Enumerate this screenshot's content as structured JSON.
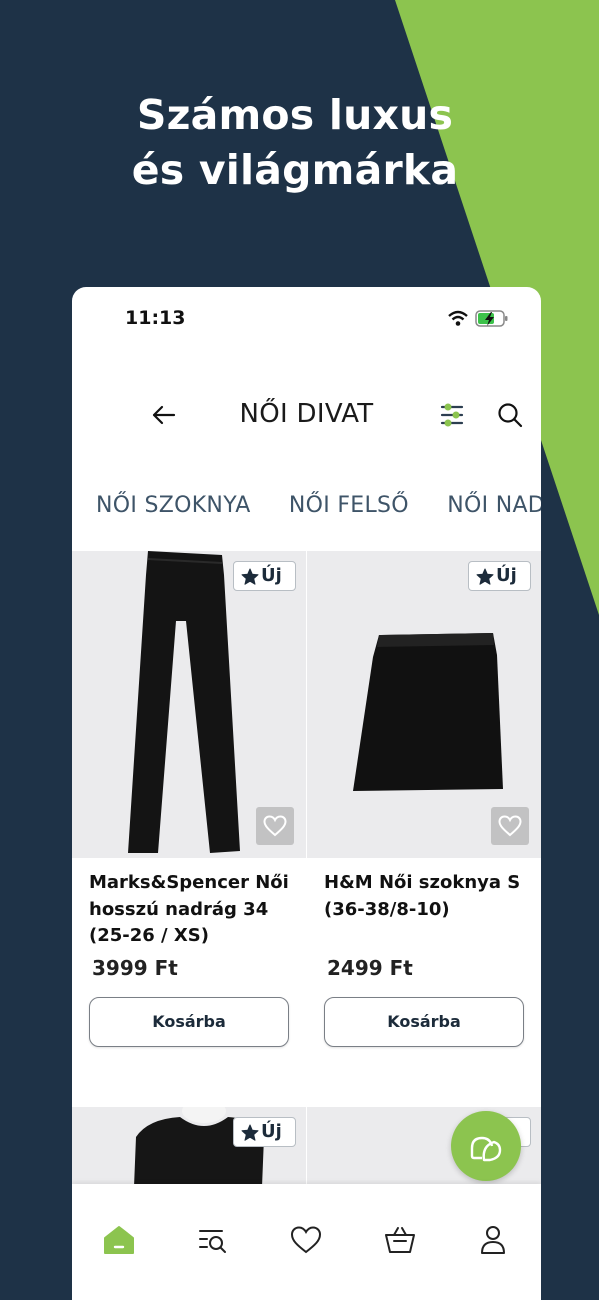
{
  "promo": {
    "headline_line1": "Számos luxus",
    "headline_line2": "és világmárka"
  },
  "status_bar": {
    "time": "11:13"
  },
  "app_bar": {
    "title": "NŐI DIVAT"
  },
  "categories": [
    "NŐI SZOKNYA",
    "NŐI FELSŐ",
    "NŐI NAD"
  ],
  "products": [
    {
      "badge": "Új",
      "name": "Marks&Spencer Női hosszú nadrág 34 (25-26 / XS)",
      "price": "3999 Ft",
      "cart_label": "Kosárba"
    },
    {
      "badge": "Új",
      "name": "H&M Női szoknya S (36-38/8-10)",
      "price": "2499 Ft",
      "cart_label": "Kosárba"
    }
  ],
  "next_row": {
    "badge": "Új"
  },
  "colors": {
    "navy": "#1e3247",
    "green": "#8cc44f",
    "accent_text": "#3e5468"
  },
  "icons": [
    "back-arrow-icon",
    "filter-icon",
    "search-icon",
    "star-icon",
    "heart-icon",
    "chat-icon",
    "home-icon",
    "browse-icon",
    "cart-icon",
    "profile-icon"
  ]
}
